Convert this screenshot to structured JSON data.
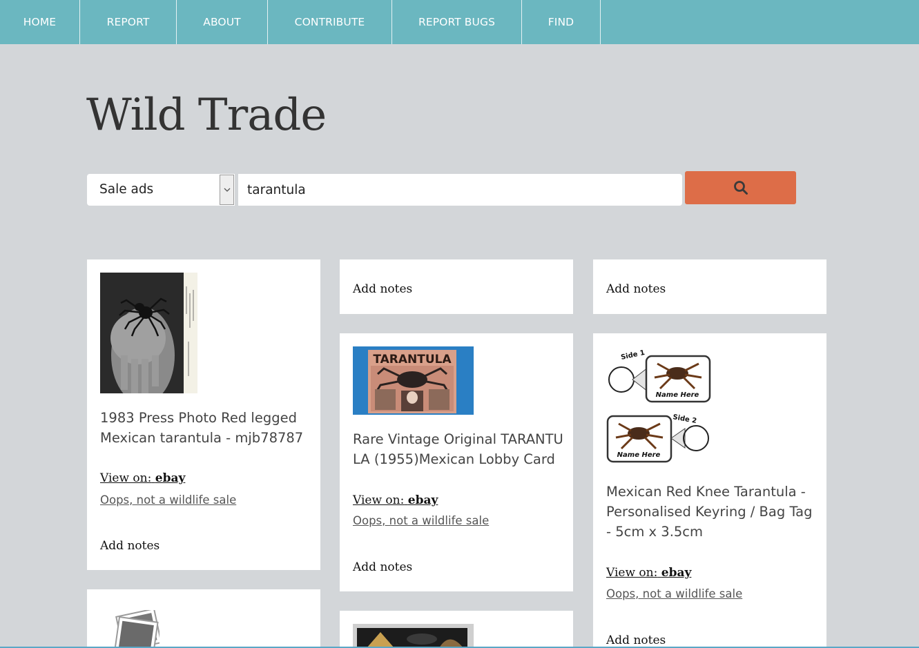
{
  "nav": {
    "items": [
      "HOME",
      "REPORT",
      "ABOUT",
      "CONTRIBUTE",
      "REPORT BUGS",
      "FIND"
    ]
  },
  "site_title": "Wild Trade",
  "search": {
    "type_selected": "Sale ads",
    "query": "tarantula",
    "button_icon": "search-icon"
  },
  "cards": [
    {
      "title": "1983 Press Photo Red legged Mexican tarantula - mjb78787",
      "view_on_label": "View on:",
      "source": "ebay",
      "oops": "Oops, not a wildlife sale",
      "notes": "Add notes"
    },
    {
      "notes": "Add notes"
    },
    {
      "notes": "Add notes"
    },
    {
      "title": "Rare Vintage Original TARANTULA (1955)Mexican Lobby Card",
      "view_on_label": "View on:",
      "source": "ebay",
      "oops": "Oops, not a wildlife sale",
      "notes": "Add notes",
      "image_text": "TARANTULA"
    },
    {
      "title": "Mexican Red Knee Tarantula - Personalised Keyring / Bag Tag - 5cm x 3.5cm",
      "view_on_label": "View on:",
      "source": "ebay",
      "oops": "Oops, not a wildlife sale",
      "notes": "Add notes",
      "image_text": {
        "side1": "Side 1",
        "side2": "Side 2",
        "name1": "Name Here",
        "name2": "Name Here"
      }
    },
    {
      "image_icon": "photo-placeholder-icon"
    },
    {}
  ],
  "colors": {
    "nav_bg": "#6bb7c0",
    "page_bg": "#d3d6d9",
    "search_button": "#dd6d48",
    "title_text": "#333333"
  }
}
